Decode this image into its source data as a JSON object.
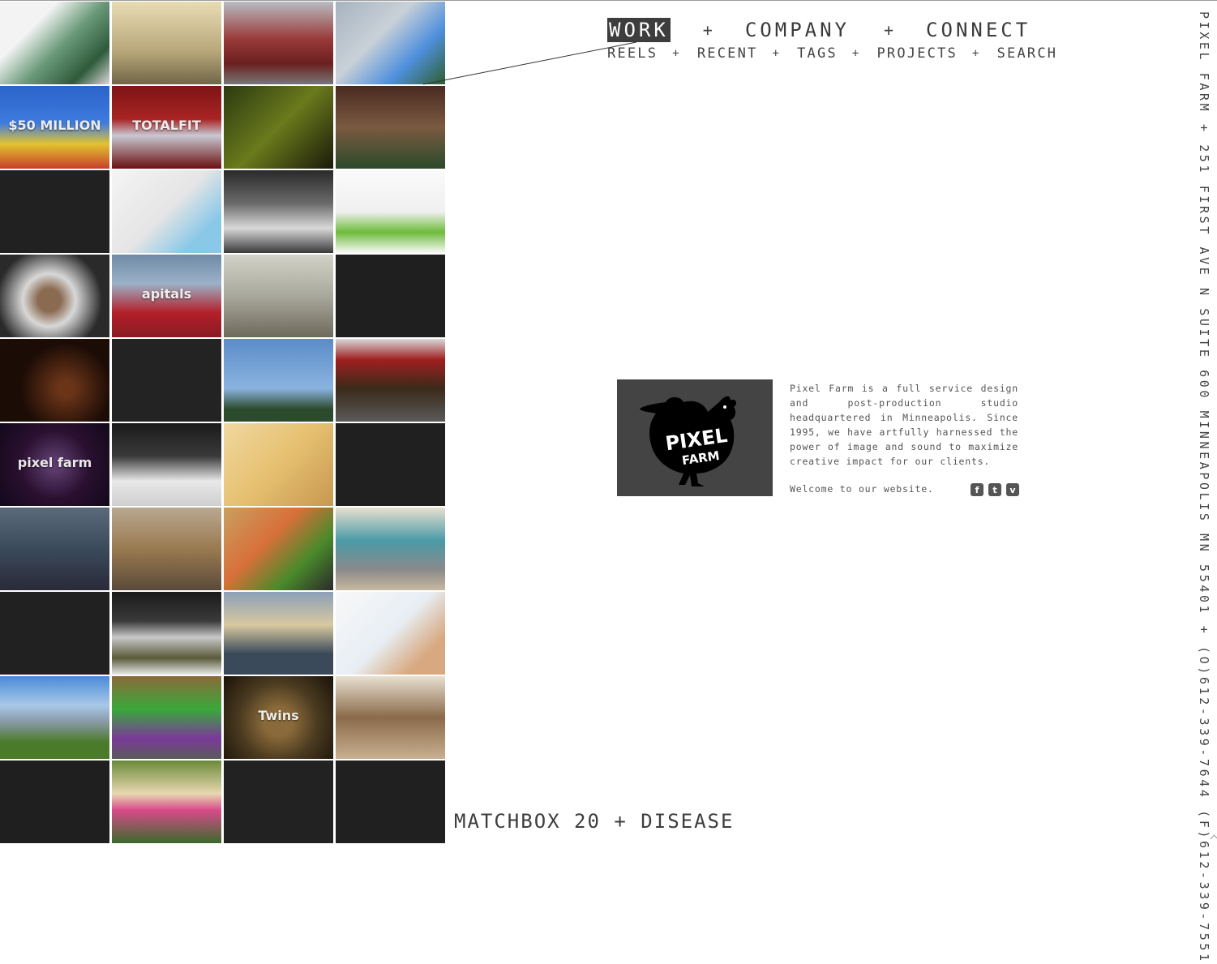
{
  "nav": {
    "main": [
      "WORK",
      "COMPANY",
      "CONNECT"
    ],
    "sub": [
      "REELS",
      "RECENT",
      "TAGS",
      "PROJECTS",
      "SEARCH"
    ],
    "separator": "+",
    "active": "WORK"
  },
  "sidebar_address": "PIXEL FARM + 251 FIRST AVE N SUITE 600 MINNEAPOLIS MN 55401 + (O)612-339-7644 (F)612-339-7551",
  "about": {
    "logo_text_1": "PIXEL",
    "logo_text_2": "FARM",
    "body": "Pixel Farm is a full service design and post-production studio headquartered in Minneapolis. Since 1995, we have artfully harnessed the power of image and sound to maximize creative impact for our clients.",
    "welcome": "Welcome to our website.",
    "social": [
      {
        "icon": "facebook-icon",
        "glyph": "f"
      },
      {
        "icon": "twitter-icon",
        "glyph": "t"
      },
      {
        "icon": "vimeo-icon",
        "glyph": "v"
      }
    ]
  },
  "caption": "MATCHBOX 20 + DISEASE",
  "tiles": [
    {
      "name": "tile-bottle-pour",
      "bg": "linear-gradient(135deg,#f3f3f3 30%,#6a9a7a 55%,#2e5a3a 80%,#d8d8d8)",
      "text": ""
    },
    {
      "name": "tile-silhouette-man",
      "bg": "linear-gradient(180deg,#e8dcb4,#b9a77a 60%,#6f6648)",
      "text": ""
    },
    {
      "name": "tile-red-van",
      "bg": "linear-gradient(180deg,#b8bcc2 0%,#9a3a3a 45%,#6b1f1f 75%,#777 100%)",
      "text": ""
    },
    {
      "name": "tile-robot-laser",
      "bg": "linear-gradient(135deg,#a6b3c0 0%,#c9d1d8 40%,#4f8fdc 70%,#2e5f2e 100%)",
      "text": ""
    },
    {
      "name": "tile-50-million",
      "bg": "linear-gradient(180deg,#2b63c9 0%,#3f7be0 45%,#e2c430 70%,#c83f2a 100%)",
      "text": "$50 MILLION"
    },
    {
      "name": "tile-sneaker",
      "bg": "linear-gradient(180deg,#7e1414,#a82424 40%,#c8c8d2 60%,#6a1010)",
      "text": "TOTALFIT"
    },
    {
      "name": "tile-man-face",
      "bg": "linear-gradient(135deg,#2c3a10,#6a7a1c 50%,#1a1a0a)",
      "text": ""
    },
    {
      "name": "tile-man-glasses",
      "bg": "linear-gradient(180deg,#4a2a20,#7a5a40 50%,#2b4a2b)",
      "text": ""
    },
    {
      "name": "tile-dark-1",
      "bg": "#212121",
      "text": ""
    },
    {
      "name": "tile-child-plane",
      "bg": "linear-gradient(135deg,#f4f4f4,#e5e5e5 50%,#8ac8e8 80%)",
      "text": ""
    },
    {
      "name": "tile-hockey",
      "bg": "linear-gradient(180deg,#2a2a2a,#6a6a6a 40%,#d9d9d9 70%,#3a3a3a)",
      "text": ""
    },
    {
      "name": "tile-baby-toy",
      "bg": "linear-gradient(180deg,#fafafa,#f0f0f0 50%,#6dbb3a 75%,#fafafa)",
      "text": ""
    },
    {
      "name": "tile-astronaut",
      "bg": "radial-gradient(circle at 45% 55%,#8a6a50 15%,#d8d8d8 35%,#2a2a2a 70%)",
      "text": ""
    },
    {
      "name": "tile-capitals-fan",
      "bg": "linear-gradient(180deg,#6f8aa6,#9bb2c8 35%,#b3202a 70%,#8a1a22)",
      "text": "apitals"
    },
    {
      "name": "tile-lobster",
      "bg": "linear-gradient(180deg,#d2d2c8,#a9a89c 50%,#6e6a5c)",
      "text": ""
    },
    {
      "name": "tile-dark-2",
      "bg": "#1f1f1f",
      "text": ""
    },
    {
      "name": "tile-silhouette-hand",
      "bg": "radial-gradient(circle at 60% 60%,#6a3418 10%,#1c0c06 55%)",
      "text": ""
    },
    {
      "name": "tile-dark-3",
      "bg": "#232323",
      "text": ""
    },
    {
      "name": "tile-snowmobile",
      "bg": "linear-gradient(180deg,#5b8cc8,#8ab3e0 60%,#2c4a2c 85%)",
      "text": ""
    },
    {
      "name": "tile-umbrella-man",
      "bg": "linear-gradient(180deg,#d8d8d8,#a02020 25%,#3a2a1a 60%,#5a5a5a)",
      "text": ""
    },
    {
      "name": "tile-pixel-farm-logo",
      "bg": "radial-gradient(circle at 50% 50%,#5a3a6a 10%,#2a1030 50%,#12081a)",
      "text": "pixel farm"
    },
    {
      "name": "tile-michelin",
      "bg": "linear-gradient(180deg,#1a1a1a,#3a3a3a 40%,#e8e8e8 70%,#cfcfcf)",
      "text": ""
    },
    {
      "name": "tile-sketch-face",
      "bg": "linear-gradient(135deg,#f0d8a0,#e6c070 50%,#c89850)",
      "text": ""
    },
    {
      "name": "tile-dark-4",
      "bg": "#202020",
      "text": ""
    },
    {
      "name": "tile-group-people",
      "bg": "linear-gradient(180deg,#5a6a7a,#3a4a5a 50%,#2a2a3a)",
      "text": ""
    },
    {
      "name": "tile-anime-girl",
      "bg": "linear-gradient(180deg,#b8a890,#9a7a50 50%,#5a4a3a)",
      "text": ""
    },
    {
      "name": "tile-swing-kids",
      "bg": "linear-gradient(135deg,#c8a060,#d8703a 40%,#4a8a2a 70%,#2a2a2a)",
      "text": ""
    },
    {
      "name": "tile-bus-man",
      "bg": "linear-gradient(180deg,#e8e0d0,#4a9aa8 40%,#8a8a8a 75%,#c8b8a0)",
      "text": ""
    },
    {
      "name": "tile-dark-5",
      "bg": "#212121",
      "text": ""
    },
    {
      "name": "tile-dancer",
      "bg": "linear-gradient(180deg,#1a1a1a,#3a3a3a 35%,#c8c8c8 55%,#5a5a3a 80%,#e8e8e8)",
      "text": ""
    },
    {
      "name": "tile-3d-glasses",
      "bg": "linear-gradient(180deg,#8aa0b8,#d8c8a0 40%,#3a4a5a 75%)",
      "text": ""
    },
    {
      "name": "tile-baby-chemistry",
      "bg": "linear-gradient(135deg,#f8f8f8,#e8eef4 50%,#d8a880 80%)",
      "text": ""
    },
    {
      "name": "tile-mountains",
      "bg": "linear-gradient(180deg,#4a8ad8,#a8c8e8 35%,#8a9aa8 55%,#4a7a2a 80%)",
      "text": ""
    },
    {
      "name": "tile-woman-purple",
      "bg": "linear-gradient(180deg,#8a6a3a,#3aa83a 40%,#7a3a9a 75%,#5a5a5a)",
      "text": ""
    },
    {
      "name": "tile-twins-coin",
      "bg": "radial-gradient(circle at 50% 55%,#8a6a3a 20%,#4a3a20 55%,#1a1208)",
      "text": "Twins"
    },
    {
      "name": "tile-ostrich",
      "bg": "linear-gradient(180deg,#e8e0d0,#8a6a4a 50%,#c8b090)",
      "text": ""
    },
    {
      "name": "tile-dark-6",
      "bg": "#1f1f1f",
      "text": ""
    },
    {
      "name": "tile-watering-can",
      "bg": "linear-gradient(180deg,#6a8a3a,#e8d8b0 40%,#d84a8a 60%,#3a6a2a)",
      "text": ""
    },
    {
      "name": "tile-dark-7",
      "bg": "#222222",
      "text": ""
    },
    {
      "name": "tile-dark-8",
      "bg": "#202020",
      "text": ""
    }
  ]
}
